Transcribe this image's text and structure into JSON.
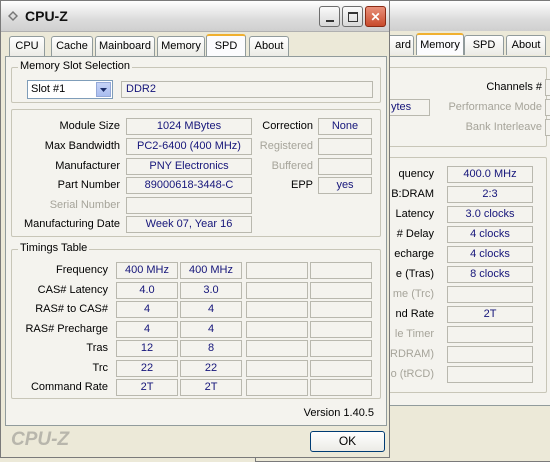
{
  "back_window": {
    "tabs": [
      {
        "label": "ard"
      },
      {
        "label": "Memory"
      },
      {
        "label": "SPD"
      },
      {
        "label": "About"
      }
    ],
    "channels_label": "Channels #",
    "size_value_partial": "ytes",
    "performance_mode_label": "Performance Mode",
    "bank_interleave_label": "Bank Interleave",
    "timings": [
      {
        "label": "quency",
        "value": "400.0 MHz"
      },
      {
        "label": "B:DRAM",
        "value": "2:3"
      },
      {
        "label": "Latency",
        "value": "3.0 clocks"
      },
      {
        "label": "# Delay",
        "value": "4 clocks"
      },
      {
        "label": "echarge",
        "value": "4 clocks"
      },
      {
        "label": "e (Tras)",
        "value": "8 clocks"
      },
      {
        "label": "me (Trc)",
        "value": ""
      },
      {
        "label": "nd Rate",
        "value": "2T"
      },
      {
        "label": "le Timer",
        "value": ""
      },
      {
        "label": "RDRAM)",
        "value": ""
      },
      {
        "label": "o (tRCD)",
        "value": ""
      }
    ]
  },
  "window": {
    "title": "CPU-Z",
    "tabs": [
      {
        "label": "CPU"
      },
      {
        "label": "Cache"
      },
      {
        "label": "Mainboard"
      },
      {
        "label": "Memory"
      },
      {
        "label": "SPD"
      },
      {
        "label": "About"
      }
    ],
    "active_tab": "SPD",
    "slot_group_title": "Memory Slot Selection",
    "slot_selected": "Slot #1",
    "slot_type": "DDR2",
    "module": {
      "module_size_label": "Module Size",
      "module_size": "1024 MBytes",
      "max_bandwidth_label": "Max Bandwidth",
      "max_bandwidth": "PC2-6400 (400 MHz)",
      "manufacturer_label": "Manufacturer",
      "manufacturer": "PNY Electronics",
      "part_number_label": "Part Number",
      "part_number": "89000618-3448-C",
      "serial_number_label": "Serial Number",
      "serial_number": "",
      "manufacturing_date_label": "Manufacturing Date",
      "manufacturing_date": "Week 07, Year 16",
      "correction_label": "Correction",
      "correction": "None",
      "registered_label": "Registered",
      "registered": "",
      "buffered_label": "Buffered",
      "buffered": "",
      "epp_label": "EPP",
      "epp": "yes"
    },
    "timings_title": "Timings Table",
    "timings": [
      {
        "label": "Frequency",
        "v1": "400 MHz",
        "v2": "400 MHz"
      },
      {
        "label": "CAS# Latency",
        "v1": "4.0",
        "v2": "3.0"
      },
      {
        "label": "RAS# to CAS#",
        "v1": "4",
        "v2": "4"
      },
      {
        "label": "RAS# Precharge",
        "v1": "4",
        "v2": "4"
      },
      {
        "label": "Tras",
        "v1": "12",
        "v2": "8"
      },
      {
        "label": "Trc",
        "v1": "22",
        "v2": "22"
      },
      {
        "label": "Command Rate",
        "v1": "2T",
        "v2": "2T"
      }
    ],
    "version": "Version 1.40.5",
    "brand": "CPU-Z",
    "ok_label": "OK"
  }
}
